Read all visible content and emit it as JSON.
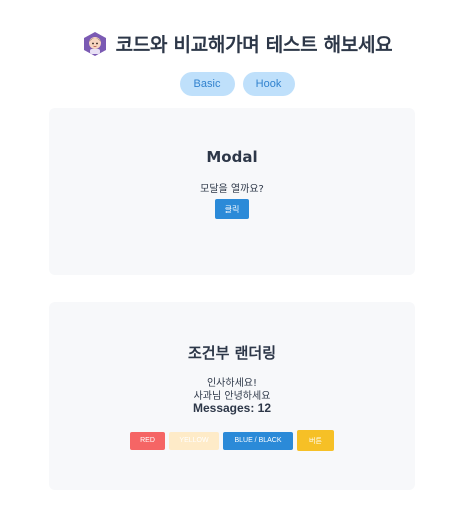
{
  "header": {
    "title": "코드와 비교해가며 테스트 해보세요",
    "icon": "avatar-icon"
  },
  "tabs": [
    {
      "label": "Basic"
    },
    {
      "label": "Hook"
    }
  ],
  "modal_card": {
    "title": "Modal",
    "prompt": "모달을 열까요?",
    "button_label": "클릭"
  },
  "conditional_card": {
    "title": "조건부 랜더링",
    "line1": "인사하세요!",
    "line2": "사과님 안녕하세요",
    "messages": "Messages: 12",
    "buttons": [
      {
        "label": "RED",
        "color": "#f56565"
      },
      {
        "label": "YELLOW",
        "color": "#feebc8"
      },
      {
        "label": "BLUE / BLACK",
        "color": "#2b8ad8"
      },
      {
        "label": "버튼",
        "color": "#f6c026"
      }
    ]
  },
  "colors": {
    "tab_bg": "#bfe0fb",
    "tab_text": "#3182ce",
    "card_bg": "#f7f8fa",
    "primary_button": "#2b8ad8"
  }
}
